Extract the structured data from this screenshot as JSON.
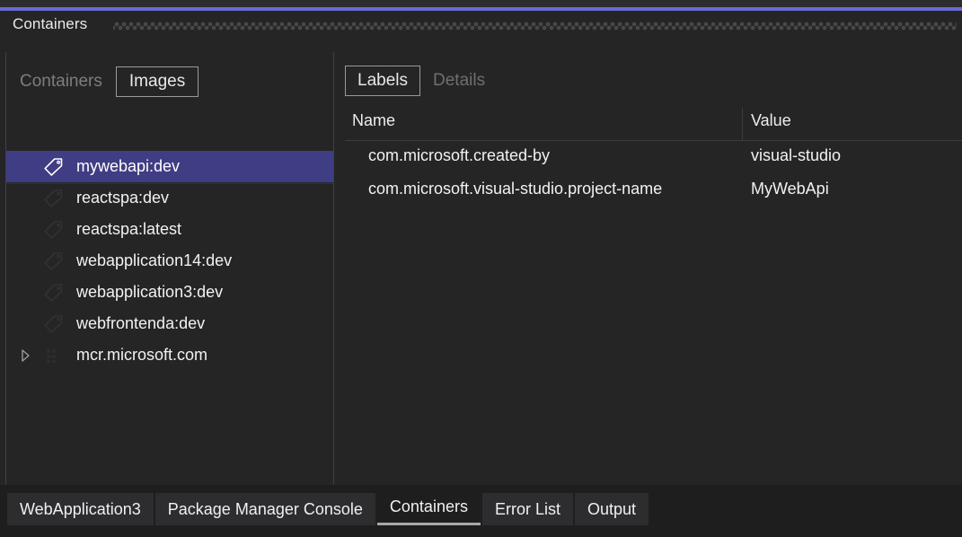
{
  "window": {
    "title": "Containers",
    "accent_color": "#6b69d6",
    "grip_icon": "dotted-grip-icon"
  },
  "left_pane": {
    "view_tabs": [
      {
        "label": "Containers",
        "state": "inactive"
      },
      {
        "label": "Images",
        "state": "focused"
      }
    ],
    "toolbar": [
      {
        "name": "run-button",
        "icon": "play-icon",
        "color": "#77d17a",
        "enabled": true
      },
      {
        "name": "run-interactive-button",
        "icon": "run-window-icon",
        "color": "#77d17a",
        "enabled": true
      },
      {
        "name": "pull-button",
        "icon": "download-arrow-icon",
        "color": "#8a8a8a",
        "enabled": false
      },
      {
        "name": "tag-button",
        "icon": "tag-icon",
        "color": "#d4d4d4",
        "enabled": true
      },
      {
        "name": "remove-button",
        "icon": "close-x-icon",
        "color": "#e05252",
        "enabled": true
      },
      {
        "name": "separator",
        "icon": "separator",
        "color": "#5a5a5a",
        "enabled": false
      },
      {
        "name": "refresh-button",
        "icon": "refresh-icon",
        "color": "#3b9bdc",
        "enabled": true
      },
      {
        "name": "prune-button",
        "icon": "prune-images-icon",
        "color": "#c9c9c9",
        "enabled": true
      }
    ],
    "tree": {
      "selected_color": "#3f3d83",
      "items": [
        {
          "label": "mywebapi:dev",
          "icon": "tag-icon",
          "selected": true,
          "expandable": false
        },
        {
          "label": "reactspa:dev",
          "icon": "tag-icon",
          "selected": false,
          "expandable": false
        },
        {
          "label": "reactspa:latest",
          "icon": "tag-icon",
          "selected": false,
          "expandable": false
        },
        {
          "label": "webapplication14:dev",
          "icon": "tag-icon",
          "selected": false,
          "expandable": false
        },
        {
          "label": "webapplication3:dev",
          "icon": "tag-icon",
          "selected": false,
          "expandable": false
        },
        {
          "label": "webfrontenda:dev",
          "icon": "tag-icon",
          "selected": false,
          "expandable": false
        },
        {
          "label": "mcr.microsoft.com",
          "icon": "registry-icon",
          "selected": false,
          "expandable": true
        }
      ]
    }
  },
  "right_pane": {
    "detail_tabs": [
      {
        "label": "Labels",
        "state": "focused"
      },
      {
        "label": "Details",
        "state": "inactive"
      }
    ],
    "grid": {
      "columns": [
        "Name",
        "Value"
      ],
      "rows": [
        {
          "name": "com.microsoft.created-by",
          "value": "visual-studio"
        },
        {
          "name": "com.microsoft.visual-studio.project-name",
          "value": "MyWebApi"
        }
      ]
    }
  },
  "bottom_tabs": [
    {
      "label": "WebApplication3",
      "active": false
    },
    {
      "label": "Package Manager Console",
      "active": false
    },
    {
      "label": "Containers",
      "active": true
    },
    {
      "label": "Error List",
      "active": false
    },
    {
      "label": "Output",
      "active": false
    }
  ]
}
